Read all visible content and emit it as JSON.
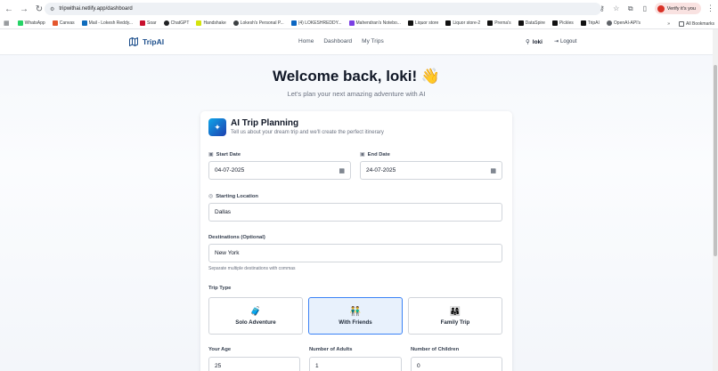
{
  "browser": {
    "url": "tripwithai.netlify.app/dashboard",
    "verify_label": "Verify it's you",
    "bookmarks": [
      "WhatsApp",
      "Canvas",
      "Mail - Lokesh Reddy...",
      "Soar",
      "ChatGPT",
      "Handshake",
      "Lokesh's Personal P...",
      "(4) LOKESHREDDY...",
      "Mahendran's Notebo...",
      "Liquor store",
      "Liquor store-2",
      "Prerna's",
      "DataSpire",
      "Pickles",
      "TripAI",
      "OpenAI-API's"
    ],
    "all_bookmarks": "All Bookmarks"
  },
  "nav": {
    "logo": "TripAI",
    "links": [
      "Home",
      "Dashboard",
      "My Trips"
    ],
    "user": "loki",
    "logout": "Logout"
  },
  "hero": {
    "title": "Welcome back, loki! 👋",
    "subtitle": "Let's plan your next amazing adventure with AI"
  },
  "form": {
    "title": "AI Trip Planning",
    "subtitle": "Tell us about your dream trip and we'll create the perfect itinerary",
    "start_date_label": "Start Date",
    "start_date": "04-07-2025",
    "end_date_label": "End Date",
    "end_date": "24-07-2025",
    "starting_location_label": "Starting Location",
    "starting_location": "Dallas",
    "destinations_label": "Destinations (Optional)",
    "destinations": "New York",
    "destinations_hint": "Separate multiple destinations with commas",
    "trip_type_label": "Trip Type",
    "trip_types": [
      {
        "label": "Solo Adventure",
        "emoji": "🧳"
      },
      {
        "label": "With Friends",
        "emoji": "👬"
      },
      {
        "label": "Family Trip",
        "emoji": "👨‍👩‍👧"
      }
    ],
    "age_label": "Your Age",
    "age": "25",
    "adults_label": "Number of Adults",
    "adults": "1",
    "children_label": "Number of Children",
    "children": "0"
  }
}
